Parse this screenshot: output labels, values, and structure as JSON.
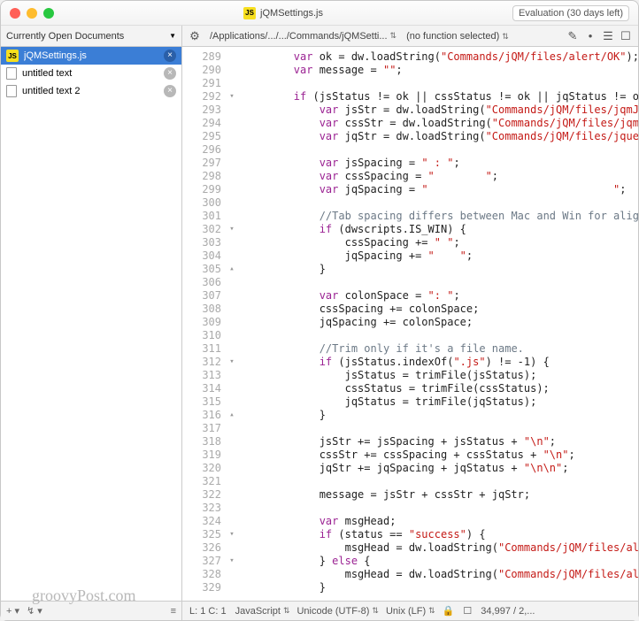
{
  "window": {
    "title": "jQMSettings.js",
    "eval_notice": "Evaluation (30 days left)"
  },
  "subbar": {
    "left_label": "Currently Open Documents",
    "path": "/Applications/.../.../Commands/jQMSetti...",
    "func_selector": "(no function selected)"
  },
  "sidebar": {
    "files": [
      {
        "name": "jQMSettings.js",
        "type": "js",
        "selected": true
      },
      {
        "name": "untitled text",
        "type": "doc",
        "selected": false
      },
      {
        "name": "untitled text 2",
        "type": "doc",
        "selected": false
      }
    ]
  },
  "code": {
    "first_line": 289,
    "fold_markers": {
      "292": "▾",
      "302": "▾",
      "305": "▴",
      "312": "▾",
      "316": "▴",
      "325": "▾",
      "327": "▾"
    },
    "lines": [
      {
        "html": "<span class='kw'>var</span> ok = dw.loadString(<span class='str'>\"Commands/jQM/files/alert/OK\"</span>);"
      },
      {
        "html": "<span class='kw'>var</span> message = <span class='str'>\"\"</span>;"
      },
      {
        "html": ""
      },
      {
        "html": "<span class='kw'>if</span> (jsStatus != ok || cssStatus != ok || jqStatus != ok"
      },
      {
        "html": "    <span class='kw'>var</span> jsStr = dw.loadString(<span class='str'>\"Commands/jQM/files/jqmJS\"</span>"
      },
      {
        "html": "    <span class='kw'>var</span> cssStr = dw.loadString(<span class='str'>\"Commands/jQM/files/jqm\"</span>"
      },
      {
        "html": "    <span class='kw'>var</span> jqStr = dw.loadString(<span class='str'>\"Commands/jQM/files/jque\"</span>"
      },
      {
        "html": ""
      },
      {
        "html": "    <span class='kw'>var</span> jsSpacing = <span class='str'>\" : \"</span>;"
      },
      {
        "html": "    <span class='kw'>var</span> cssSpacing = <span class='str'>\"        \"</span>;"
      },
      {
        "html": "    <span class='kw'>var</span> jqSpacing = <span class='str'>\"                             \"</span>;"
      },
      {
        "html": ""
      },
      {
        "html": "    <span class='cmnt'>//Tab spacing differs between Mac and Win for alig</span>"
      },
      {
        "html": "    <span class='kw'>if</span> (dwscripts.IS_WIN) {"
      },
      {
        "html": "        cssSpacing += <span class='str'>\" \"</span>;"
      },
      {
        "html": "        jqSpacing += <span class='str'>\"    \"</span>;"
      },
      {
        "html": "    }"
      },
      {
        "html": ""
      },
      {
        "html": "    <span class='kw'>var</span> colonSpace = <span class='str'>\": \"</span>;"
      },
      {
        "html": "    cssSpacing += colonSpace;"
      },
      {
        "html": "    jqSpacing += colonSpace;"
      },
      {
        "html": ""
      },
      {
        "html": "    <span class='cmnt'>//Trim only if it's a file name.</span>"
      },
      {
        "html": "    <span class='kw'>if</span> (jsStatus.indexOf(<span class='str'>\".js\"</span>) != -1) {"
      },
      {
        "html": "        jsStatus = trimFile(jsStatus);"
      },
      {
        "html": "        cssStatus = trimFile(cssStatus);"
      },
      {
        "html": "        jqStatus = trimFile(jqStatus);"
      },
      {
        "html": "    }"
      },
      {
        "html": ""
      },
      {
        "html": "    jsStr += jsSpacing + jsStatus + <span class='str'>\"\\n\"</span>;"
      },
      {
        "html": "    cssStr += cssSpacing + cssStatus + <span class='str'>\"\\n\"</span>;"
      },
      {
        "html": "    jqStr += jqSpacing + jqStatus + <span class='str'>\"\\n\\n\"</span>;"
      },
      {
        "html": ""
      },
      {
        "html": "    message = jsStr + cssStr + jqStr;"
      },
      {
        "html": ""
      },
      {
        "html": "    <span class='kw'>var</span> msgHead;"
      },
      {
        "html": "    <span class='kw'>if</span> (status == <span class='str'>\"success\"</span>) {"
      },
      {
        "html": "        msgHead = dw.loadString(<span class='str'>\"Commands/jQM/files/ale\"</span>"
      },
      {
        "html": "    } <span class='kw'>else</span> {"
      },
      {
        "html": "        msgHead = dw.loadString(<span class='str'>\"Commands/jQM/files/ale\"</span>"
      },
      {
        "html": "    }"
      }
    ]
  },
  "status": {
    "cursor": "L: 1 C: 1",
    "language": "JavaScript",
    "encoding": "Unicode (UTF-8)",
    "lineend": "Unix (LF)",
    "size": "34,997 / 2,..."
  },
  "watermark": "groovyPost.com"
}
